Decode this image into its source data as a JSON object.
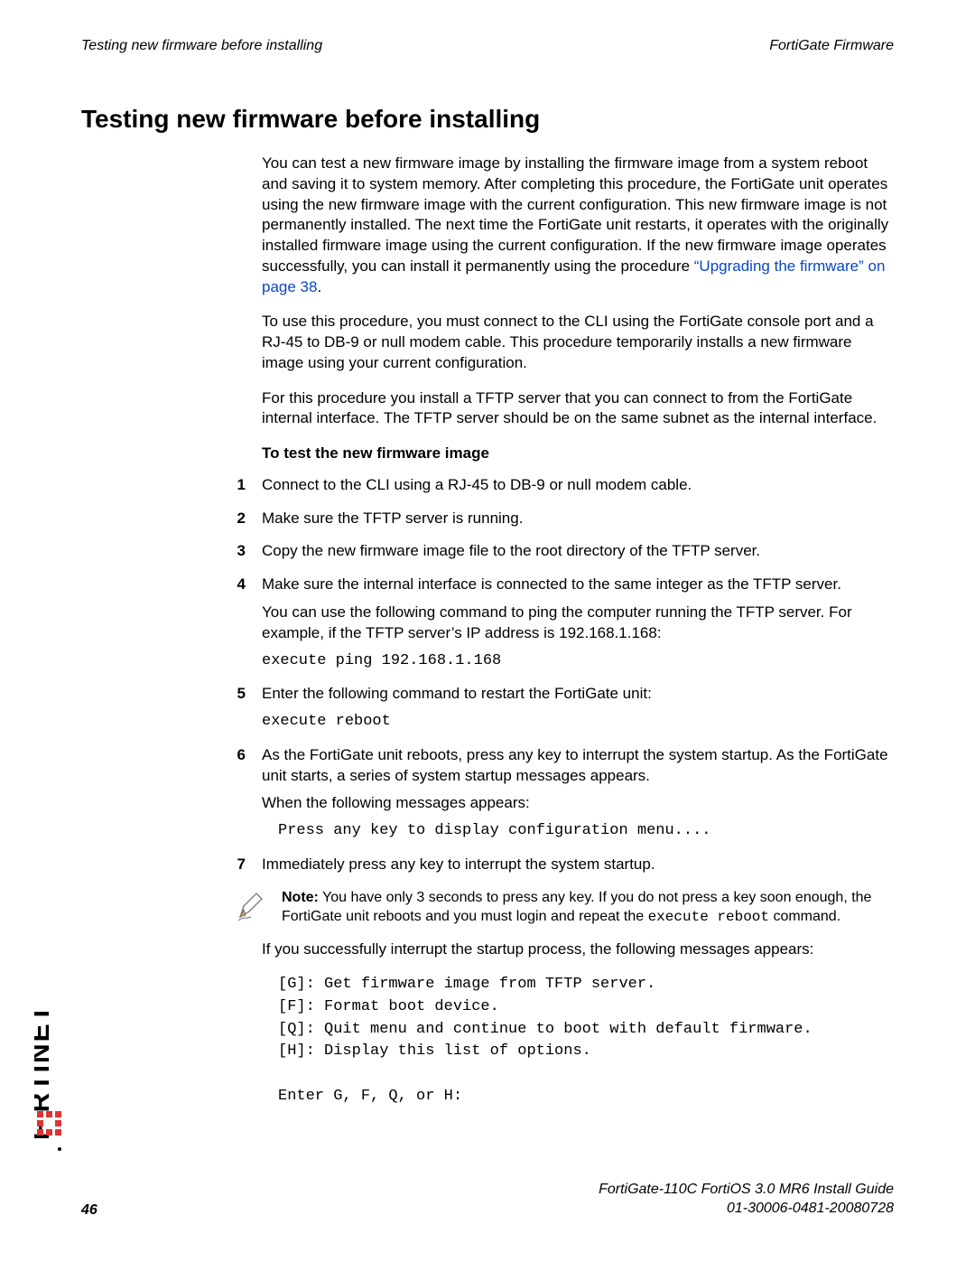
{
  "header": {
    "left": "Testing new firmware before installing",
    "right": "FortiGate Firmware"
  },
  "heading": "Testing new firmware before installing",
  "intro": {
    "p1a": "You can test a new firmware image by installing the firmware image from a system reboot and saving it to system memory. After completing this procedure, the FortiGate unit operates using the new firmware image with the current configuration. This new firmware image is not permanently installed. The next time the FortiGate unit restarts, it operates with the originally installed firmware image using the current configuration. If the new firmware image operates successfully, you can install it permanently using the procedure ",
    "p1link": "“Upgrading the firmware” on page 38",
    "p1b": ".",
    "p2": "To use this procedure, you must connect to the CLI using the FortiGate console port and a RJ-45 to DB-9 or null modem cable. This procedure temporarily installs a new firmware image using your current configuration.",
    "p3": "For this procedure you install a TFTP server that you can connect to from the FortiGate internal interface. The TFTP server should be on the same subnet as the internal interface."
  },
  "subheading": "To test the new firmware image",
  "steps": {
    "n1": "1",
    "s1": "Connect to the CLI using a RJ-45 to DB-9 or null modem cable.",
    "n2": "2",
    "s2": "Make sure the TFTP server is running.",
    "n3": "3",
    "s3": "Copy the new firmware image file to the root directory of the TFTP server.",
    "n4": "4",
    "s4a": "Make sure the internal interface is connected to the same integer as the TFTP server.",
    "s4b": "You can use the following command to ping the computer running the TFTP server. For example, if the TFTP server’s IP address is 192.168.1.168:",
    "s4c": "execute ping 192.168.1.168",
    "n5": "5",
    "s5a": "Enter the following command to restart the FortiGate unit:",
    "s5b": "execute reboot",
    "n6": "6",
    "s6a": "As the FortiGate unit reboots, press any key to interrupt the system startup. As the FortiGate unit starts, a series of system startup messages appears.",
    "s6b": "When the following messages appears:",
    "s6c": "Press any key to display configuration menu....",
    "n7": "7",
    "s7": "Immediately press any key to interrupt the system startup."
  },
  "note": {
    "label": "Note:",
    "a": " You have only 3 seconds to press any key. If you do not press a key soon enough, the ",
    "fg": "FortiGate",
    "b": " unit reboots and you must login and repeat the ",
    "cmd": "execute reboot",
    "c": " command."
  },
  "after_note": {
    "p": "If you successfully interrupt the startup process, the following messages appears:",
    "menu": "[G]: Get firmware image from TFTP server.\n[F]: Format boot device.\n[Q]: Quit menu and continue to boot with default firmware.\n[H]: Display this list of options.\n\nEnter G, F, Q, or H:"
  },
  "footer": {
    "pagenum": "46",
    "guide": "FortiGate-110C FortiOS 3.0 MR6 Install Guide",
    "docnum": "01-30006-0481-20080728"
  }
}
